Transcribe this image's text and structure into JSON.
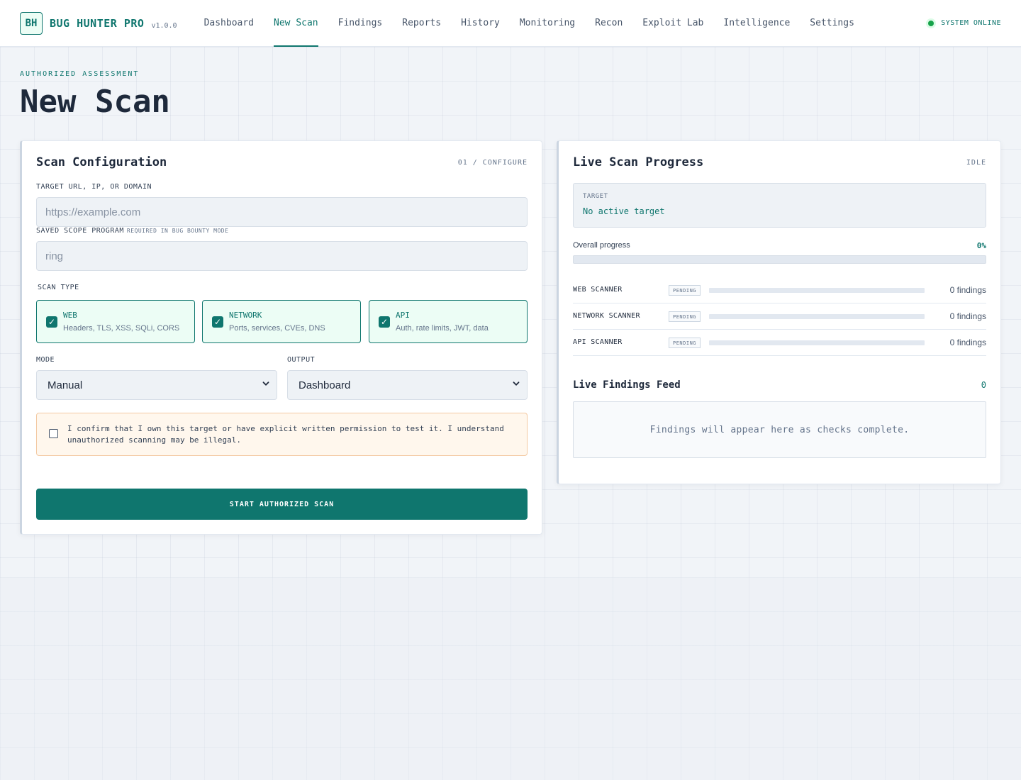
{
  "app": {
    "logo": "BH",
    "name": "BUG HUNTER PRO",
    "version": "v1.0.0",
    "status": "SYSTEM ONLINE"
  },
  "nav": [
    {
      "label": "Dashboard",
      "active": false
    },
    {
      "label": "New Scan",
      "active": true
    },
    {
      "label": "Findings",
      "active": false
    },
    {
      "label": "Reports",
      "active": false
    },
    {
      "label": "History",
      "active": false
    },
    {
      "label": "Monitoring",
      "active": false
    },
    {
      "label": "Recon",
      "active": false
    },
    {
      "label": "Exploit Lab",
      "active": false
    },
    {
      "label": "Intelligence",
      "active": false
    },
    {
      "label": "Settings",
      "active": false
    }
  ],
  "page": {
    "eyebrow": "AUTHORIZED ASSESSMENT",
    "title": "New Scan"
  },
  "config": {
    "title": "Scan Configuration",
    "tag": "01 / CONFIGURE",
    "target": {
      "label": "TARGET URL, IP, OR DOMAIN",
      "placeholder": "https://example.com",
      "value": ""
    },
    "scope": {
      "label": "SAVED SCOPE PROGRAM",
      "sublabel": "REQUIRED IN BUG BOUNTY MODE",
      "placeholder": "ring",
      "value": ""
    },
    "scan_type_label": "SCAN TYPE",
    "scan_types": [
      {
        "title": "WEB",
        "desc": "Headers, TLS, XSS, SQLi, CORS",
        "checked": true
      },
      {
        "title": "NETWORK",
        "desc": "Ports, services, CVEs, DNS",
        "checked": true
      },
      {
        "title": "API",
        "desc": "Auth, rate limits, JWT, data",
        "checked": true
      }
    ],
    "mode": {
      "label": "MODE",
      "value": "Manual"
    },
    "output": {
      "label": "OUTPUT",
      "value": "Dashboard"
    },
    "consent": {
      "text": "I confirm that I own this target or have explicit written permission to test it. I understand unauthorized scanning may be illegal.",
      "checked": false
    },
    "start_label": "START AUTHORIZED SCAN"
  },
  "progress": {
    "title": "Live Scan Progress",
    "state": "IDLE",
    "target_label": "TARGET",
    "target_value": "No active target",
    "overall_label": "Overall progress",
    "overall_pct": "0%",
    "overall_fraction": 0,
    "scanners": [
      {
        "name": "WEB SCANNER",
        "status": "PENDING",
        "fraction": 0,
        "findings": "0 findings"
      },
      {
        "name": "NETWORK SCANNER",
        "status": "PENDING",
        "fraction": 0,
        "findings": "0 findings"
      },
      {
        "name": "API SCANNER",
        "status": "PENDING",
        "fraction": 0,
        "findings": "0 findings"
      }
    ],
    "feed_title": "Live Findings Feed",
    "feed_count": "0",
    "feed_empty": "Findings will appear here as checks complete."
  },
  "colors": {
    "accent": "#0f766e",
    "accent_light": "#ecfdf5",
    "warning_bg": "#fff7ed",
    "status_online": "#16a34a"
  }
}
